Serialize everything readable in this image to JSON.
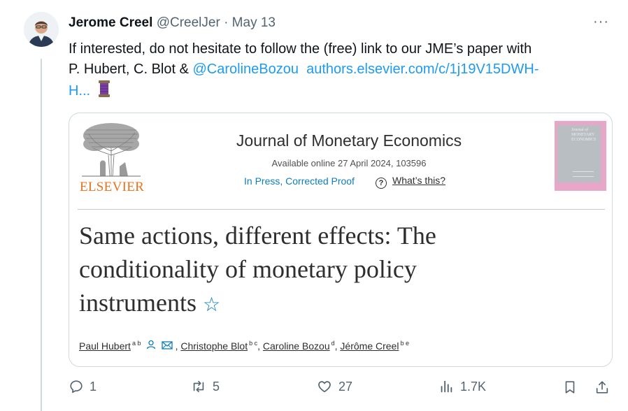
{
  "tweet": {
    "author_name": "Jerome Creel",
    "handle": "@CreelJer",
    "separator": "·",
    "date": "May 13",
    "more": "···",
    "text_line1": "If interested, do not hesitate to follow the (free) link to our JME’s paper with",
    "text_line2_plain": "P. Hubert, C. Blot & ",
    "mention": "@CarolineBozou",
    "url_part1": "authors.elsevier.com/c/1j19V15DWH-",
    "url_part2": "H...",
    "emoji": "thread-spool-emoji"
  },
  "card": {
    "publisher": "ELSEVIER",
    "journal": "Journal of Monetary Economics",
    "available": "Available online 27 April 2024, 103596",
    "in_press": "In Press, Corrected Proof",
    "whats_this_symbol": "?",
    "whats_this": "What’s this?",
    "cover_text": "Journal of MONETARY ECONOMICS",
    "paper_title_line1": "Same actions, different effects: The",
    "paper_title_line2": "conditionality of monetary policy",
    "paper_title_line3": "instruments",
    "star": "☆",
    "authors": [
      {
        "name": "Paul Hubert",
        "sup": "a b"
      },
      {
        "name": "Christophe Blot",
        "sup": "b c"
      },
      {
        "name": "Caroline Bozou",
        "sup": "d"
      },
      {
        "name": "Jérôme Creel",
        "sup": "b e"
      }
    ],
    "comma": ","
  },
  "actions": {
    "replies": "1",
    "reposts": "5",
    "likes": "27",
    "views": "1.7K"
  },
  "colors": {
    "link": "#1d9bf0",
    "elsevier_orange": "#e9711c",
    "sd_blue": "#0c7dbb",
    "muted": "#536471"
  }
}
